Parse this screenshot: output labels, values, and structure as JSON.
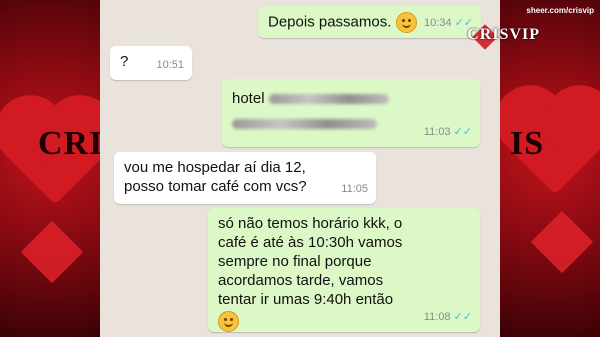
{
  "watermark": "sheer.com/crisvip",
  "logo": "CRISVIP",
  "side_text": {
    "left": "CRI",
    "right": "IS"
  },
  "messages": [
    {
      "id": "m1",
      "direction": "out",
      "text": "Depois passamos.",
      "emoji": "smirk-emoji",
      "time": "10:34",
      "ticks": "✓✓"
    },
    {
      "id": "m2",
      "direction": "in",
      "text": "?",
      "time": "10:51"
    },
    {
      "id": "m3",
      "direction": "out",
      "text": "hotel",
      "redacted": true,
      "time": "11:03",
      "ticks": "✓✓"
    },
    {
      "id": "m4",
      "direction": "in",
      "line1": "vou me hospedar aí dia 12,",
      "line2": "posso tomar café com vcs?",
      "time": "11:05"
    },
    {
      "id": "m5",
      "direction": "out",
      "line1": "só não temos horário kkk, o",
      "line2": "café é até às 10:30h vamos",
      "line3": "sempre no final porque",
      "line4": "acordamos tarde, vamos",
      "line5": "tentar ir umas 9:40h então",
      "emoji": "smile-emoji",
      "time": "11:08",
      "ticks": "✓✓"
    }
  ],
  "colors": {
    "incoming": "#ffffff",
    "outgoing": "#dcf8c6",
    "chat_bg": "#e9e3dc",
    "tick": "#4fb6ec",
    "side_bg": "#c3141c"
  }
}
